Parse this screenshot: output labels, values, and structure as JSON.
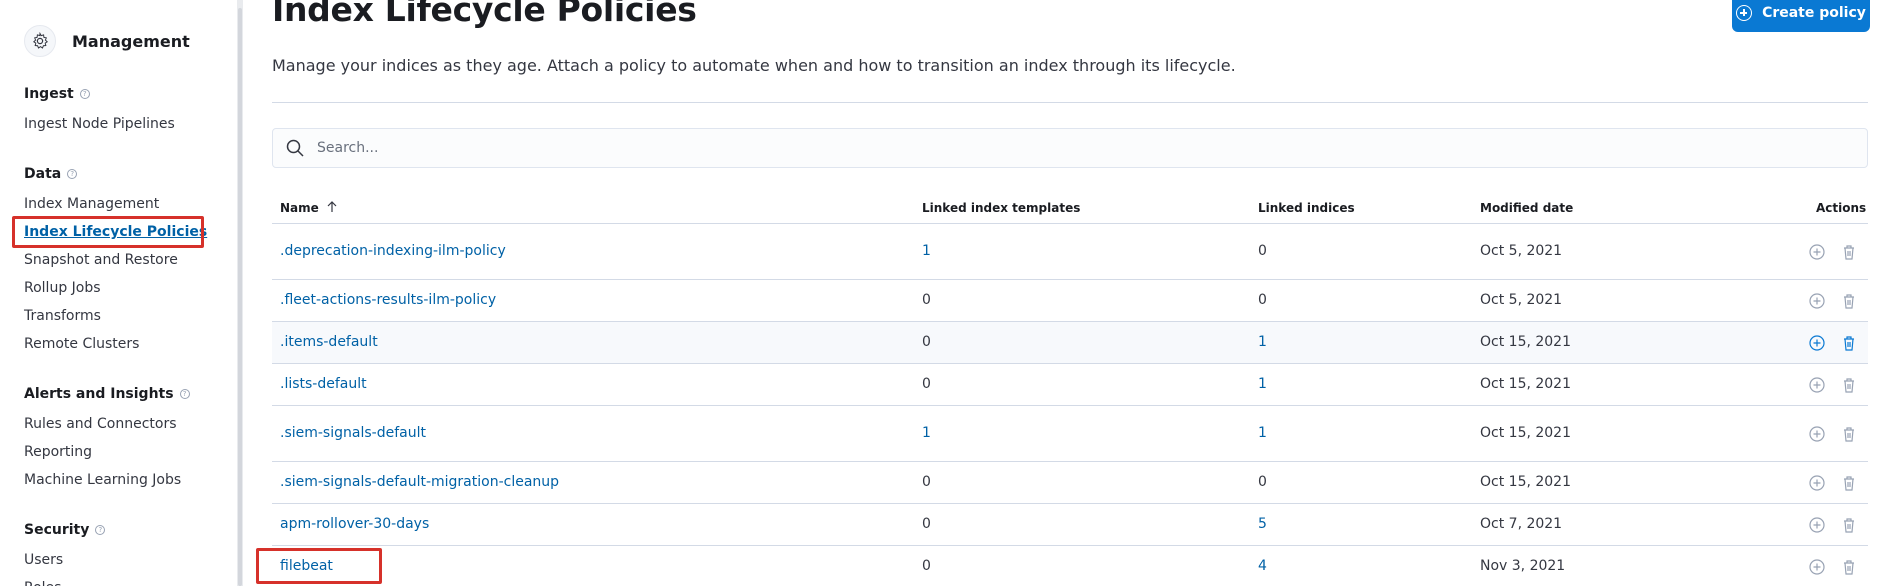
{
  "app": {
    "title": "Management",
    "icon": "gear-icon"
  },
  "sidebar": {
    "groups": [
      {
        "title": "Ingest",
        "items": [
          "Ingest Node Pipelines"
        ]
      },
      {
        "title": "Data",
        "items": [
          "Index Management",
          "Index Lifecycle Policies",
          "Snapshot and Restore",
          "Rollup Jobs",
          "Transforms",
          "Remote Clusters"
        ]
      },
      {
        "title": "Alerts and Insights",
        "items": [
          "Rules and Connectors",
          "Reporting",
          "Machine Learning Jobs"
        ]
      },
      {
        "title": "Security",
        "items": [
          "Users",
          "Roles"
        ]
      }
    ],
    "active_item": "Index Lifecycle Policies"
  },
  "page": {
    "title": "Index Lifecycle Policies",
    "create_button": "Create policy",
    "description": "Manage your indices as they age. Attach a policy to automate when and how to transition an index through its lifecycle."
  },
  "search": {
    "placeholder": "Search..."
  },
  "table": {
    "headers": {
      "name": "Name",
      "templates": "Linked index templates",
      "indices": "Linked indices",
      "date": "Modified date",
      "actions": "Actions"
    },
    "rows": [
      {
        "name": ".deprecation-indexing-ilm-policy",
        "templates": "1",
        "indices": "0",
        "date": "Oct 5, 2021"
      },
      {
        "name": ".fleet-actions-results-ilm-policy",
        "templates": "0",
        "indices": "0",
        "date": "Oct 5, 2021"
      },
      {
        "name": ".items-default",
        "templates": "0",
        "indices": "1",
        "date": "Oct 15, 2021"
      },
      {
        "name": ".lists-default",
        "templates": "0",
        "indices": "1",
        "date": "Oct 15, 2021"
      },
      {
        "name": ".siem-signals-default",
        "templates": "1",
        "indices": "1",
        "date": "Oct 15, 2021"
      },
      {
        "name": ".siem-signals-default-migration-cleanup",
        "templates": "0",
        "indices": "0",
        "date": "Oct 15, 2021"
      },
      {
        "name": "apm-rollover-30-days",
        "templates": "0",
        "indices": "5",
        "date": "Oct 7, 2021"
      },
      {
        "name": "filebeat",
        "templates": "0",
        "indices": "4",
        "date": "Nov 3, 2021"
      }
    ]
  },
  "colors": {
    "accent": "#0a79d3",
    "link": "#0061a6",
    "highlight": "#d6312a"
  }
}
